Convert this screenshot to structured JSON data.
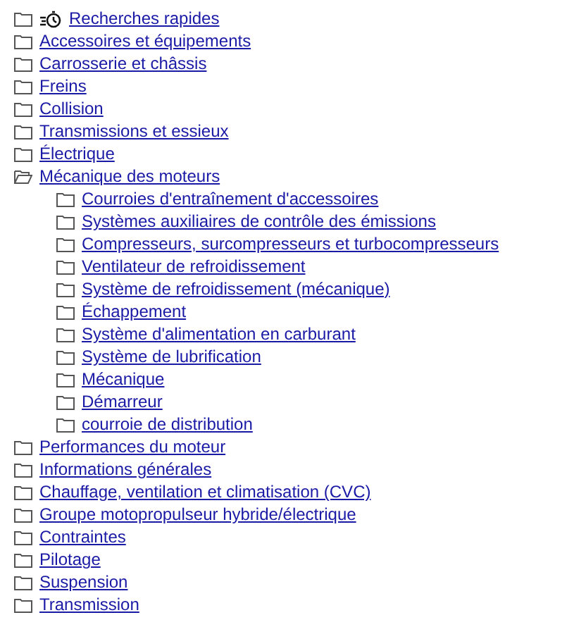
{
  "tree": [
    {
      "label": "Recherches rapides",
      "kind": "quick",
      "expanded": false
    },
    {
      "label": "Accessoires et équipements",
      "kind": "folder",
      "expanded": false
    },
    {
      "label": "Carrosserie et châssis",
      "kind": "folder",
      "expanded": false
    },
    {
      "label": "Freins",
      "kind": "folder",
      "expanded": false
    },
    {
      "label": "Collision",
      "kind": "folder",
      "expanded": false
    },
    {
      "label": "Transmissions et essieux",
      "kind": "folder",
      "expanded": false
    },
    {
      "label": "Électrique",
      "kind": "folder",
      "expanded": false
    },
    {
      "label": "Mécanique des moteurs",
      "kind": "folder",
      "expanded": true,
      "children": [
        {
          "label": "Courroies d'entraînement d'accessoires",
          "kind": "folder",
          "expanded": false
        },
        {
          "label": "Systèmes auxiliaires de contrôle des émissions",
          "kind": "folder",
          "expanded": false
        },
        {
          "label": "Compresseurs, surcompresseurs et turbocompresseurs",
          "kind": "folder",
          "expanded": false
        },
        {
          "label": "Ventilateur de refroidissement",
          "kind": "folder",
          "expanded": false
        },
        {
          "label": "Système de refroidissement (mécanique)",
          "kind": "folder",
          "expanded": false
        },
        {
          "label": "Échappement",
          "kind": "folder",
          "expanded": false
        },
        {
          "label": "Système d'alimentation en carburant",
          "kind": "folder",
          "expanded": false
        },
        {
          "label": "Système de lubrification",
          "kind": "folder",
          "expanded": false
        },
        {
          "label": "Mécanique",
          "kind": "folder",
          "expanded": false
        },
        {
          "label": "Démarreur",
          "kind": "folder",
          "expanded": false
        },
        {
          "label": "courroie de distribution",
          "kind": "folder",
          "expanded": false
        }
      ]
    },
    {
      "label": "Performances du moteur",
      "kind": "folder",
      "expanded": false
    },
    {
      "label": "Informations générales",
      "kind": "folder",
      "expanded": false
    },
    {
      "label": "Chauffage, ventilation et climatisation (CVC)",
      "kind": "folder",
      "expanded": false
    },
    {
      "label": "Groupe motopropulseur hybride/électrique",
      "kind": "folder",
      "expanded": false
    },
    {
      "label": "Contraintes",
      "kind": "folder",
      "expanded": false
    },
    {
      "label": "Pilotage",
      "kind": "folder",
      "expanded": false
    },
    {
      "label": "Suspension",
      "kind": "folder",
      "expanded": false
    },
    {
      "label": "Transmission",
      "kind": "folder",
      "expanded": false
    }
  ]
}
